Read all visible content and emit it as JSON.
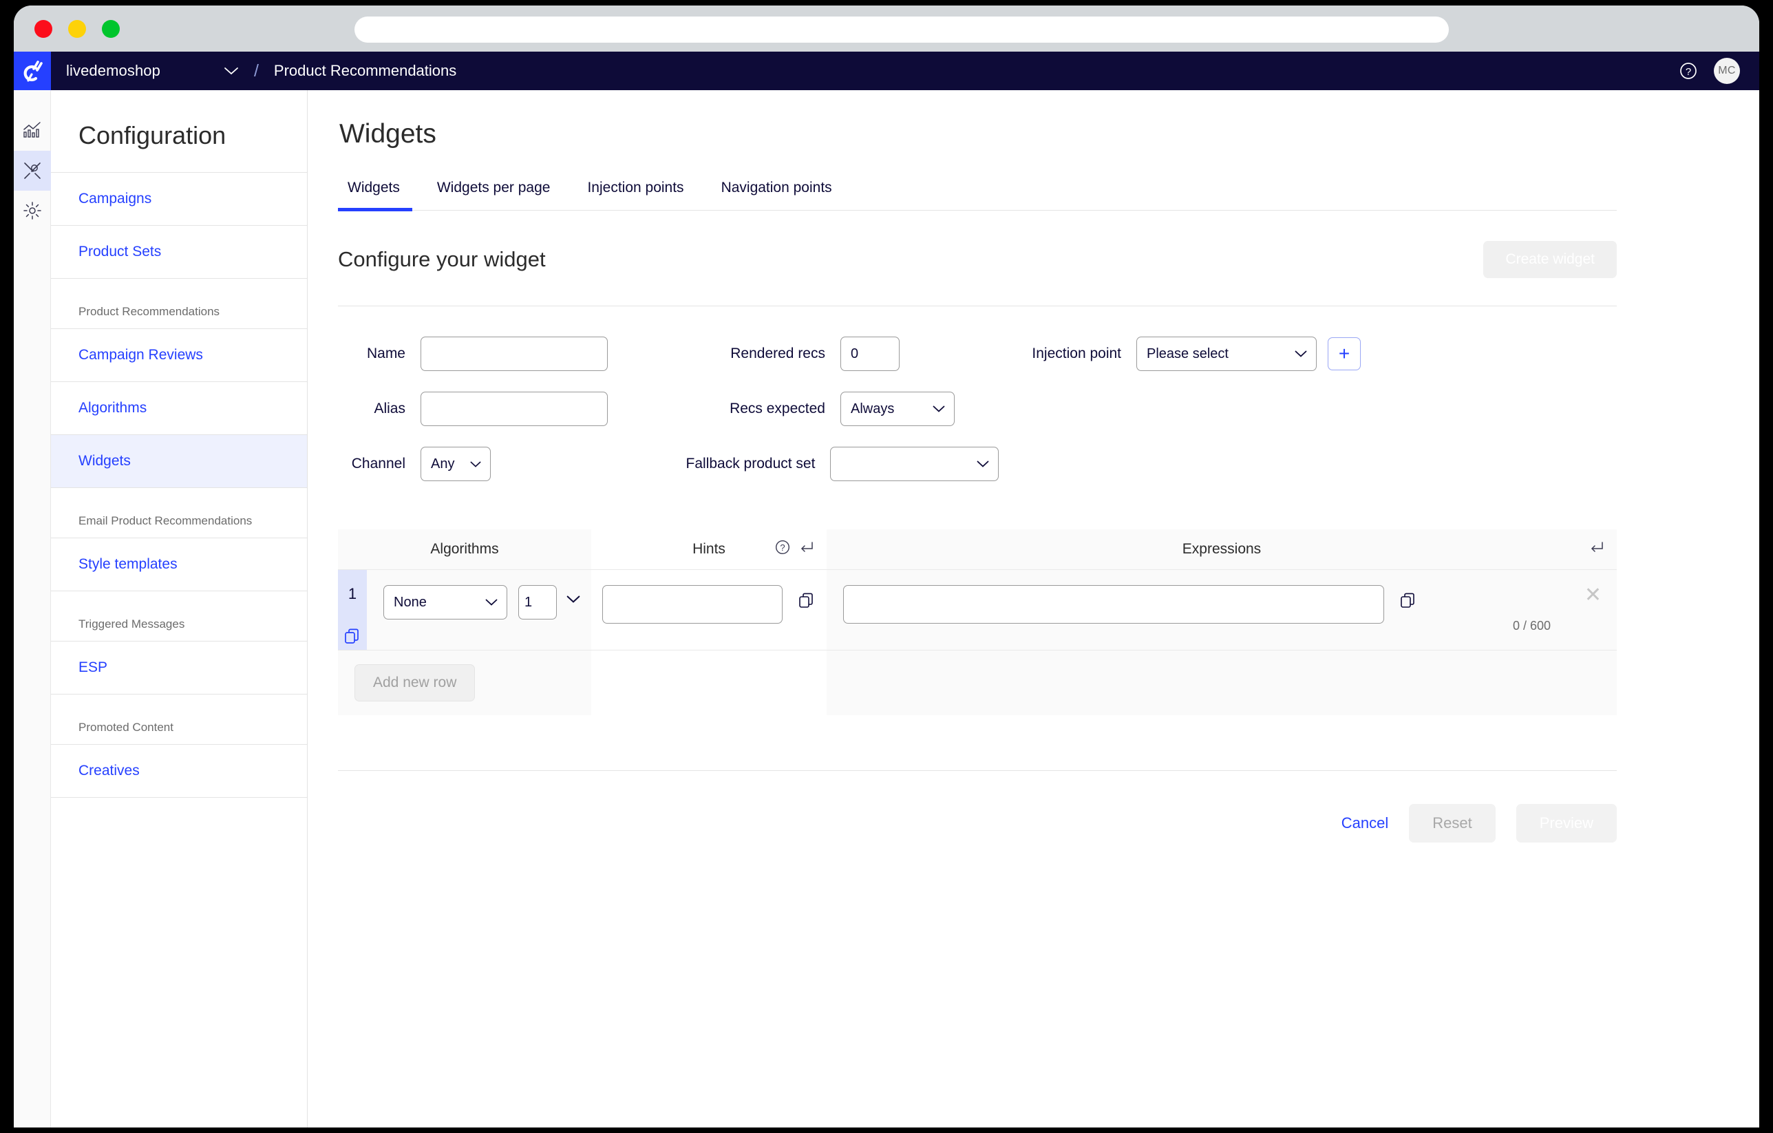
{
  "browser": {
    "url_value": "",
    "url_placeholder": "",
    "traffic_lights": [
      "close",
      "minimize",
      "maximize"
    ]
  },
  "topbar": {
    "shop_name": "livedemoshop",
    "separator": "/",
    "breadcrumb": "Product Recommendations",
    "help_icon": "question-circle-icon",
    "avatar_initials": "MC",
    "brand_color": "#2540ff",
    "bar_color": "#0e0b38"
  },
  "rail": {
    "items": [
      {
        "name": "analytics-icon",
        "active": false
      },
      {
        "name": "tools-icon",
        "active": true
      },
      {
        "name": "gear-icon",
        "active": false
      }
    ]
  },
  "sidebar": {
    "title": "Configuration",
    "items": [
      {
        "label": "Campaigns",
        "type": "link",
        "active": false
      },
      {
        "label": "Product Sets",
        "type": "link",
        "active": false
      },
      {
        "label": "Product Recommendations",
        "type": "heading"
      },
      {
        "label": "Campaign Reviews",
        "type": "link",
        "active": false
      },
      {
        "label": "Algorithms",
        "type": "link",
        "active": false
      },
      {
        "label": "Widgets",
        "type": "link",
        "active": true
      },
      {
        "label": "Email Product Recommendations",
        "type": "heading"
      },
      {
        "label": "Style templates",
        "type": "link",
        "active": false
      },
      {
        "label": "Triggered Messages",
        "type": "heading"
      },
      {
        "label": "ESP",
        "type": "link",
        "active": false
      },
      {
        "label": "Promoted Content",
        "type": "heading"
      },
      {
        "label": "Creatives",
        "type": "link",
        "active": false
      }
    ]
  },
  "main": {
    "page_title": "Widgets",
    "tabs": [
      {
        "label": "Widgets",
        "active": true
      },
      {
        "label": "Widgets per page",
        "active": false
      },
      {
        "label": "Injection points",
        "active": false
      },
      {
        "label": "Navigation points",
        "active": false
      }
    ],
    "section_title": "Configure your widget",
    "create_button": "Create widget",
    "form": {
      "name_label": "Name",
      "name_value": "",
      "alias_label": "Alias",
      "alias_value": "",
      "channel_label": "Channel",
      "channel_value": "Any",
      "rendered_recs_label": "Rendered recs",
      "rendered_recs_value": "0",
      "recs_expected_label": "Recs expected",
      "recs_expected_value": "Always",
      "fallback_label": "Fallback product set",
      "fallback_value": "",
      "injection_label": "Injection point",
      "injection_value": "Please select",
      "add_injection_label": "+"
    },
    "table": {
      "headers": {
        "algorithms": "Algorithms",
        "hints": "Hints",
        "expressions": "Expressions"
      },
      "rows": [
        {
          "number": "1",
          "algorithm": "None",
          "count": "1",
          "hints_value": "",
          "expression_value": "",
          "counter": "0 / 600"
        }
      ],
      "add_row_label": "Add new row"
    },
    "actions": {
      "cancel": "Cancel",
      "reset": "Reset",
      "preview": "Preview"
    }
  }
}
